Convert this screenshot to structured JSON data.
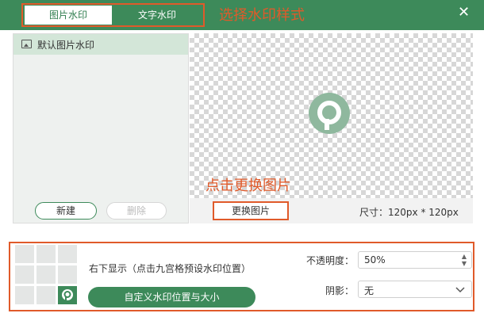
{
  "tabs": [
    {
      "label": "图片水印",
      "active": true
    },
    {
      "label": "文字水印",
      "active": false
    }
  ],
  "annotations": {
    "select_style": "选择水印样式",
    "click_change": "点击更换图片"
  },
  "list": {
    "items": [
      {
        "label": "默认图片水印",
        "selected": true
      }
    ]
  },
  "buttons": {
    "new": "新建",
    "delete": "删除",
    "change_image": "更换图片",
    "custom_position": "自定义水印位置与大小"
  },
  "preview": {
    "size_label": "尺寸：120px * 120px",
    "watermark_icon": "wps-logo-icon"
  },
  "position": {
    "text": "右下显示（点击九宫格预设水印位置）",
    "grid_selected": "bottom-right"
  },
  "settings": {
    "opacity_label": "不透明度：",
    "opacity_value": "50%",
    "shadow_label": "阴影：",
    "shadow_value": "无"
  },
  "colors": {
    "brand_green": "#3d8a5a",
    "annotation_orange": "#e05a2a"
  }
}
